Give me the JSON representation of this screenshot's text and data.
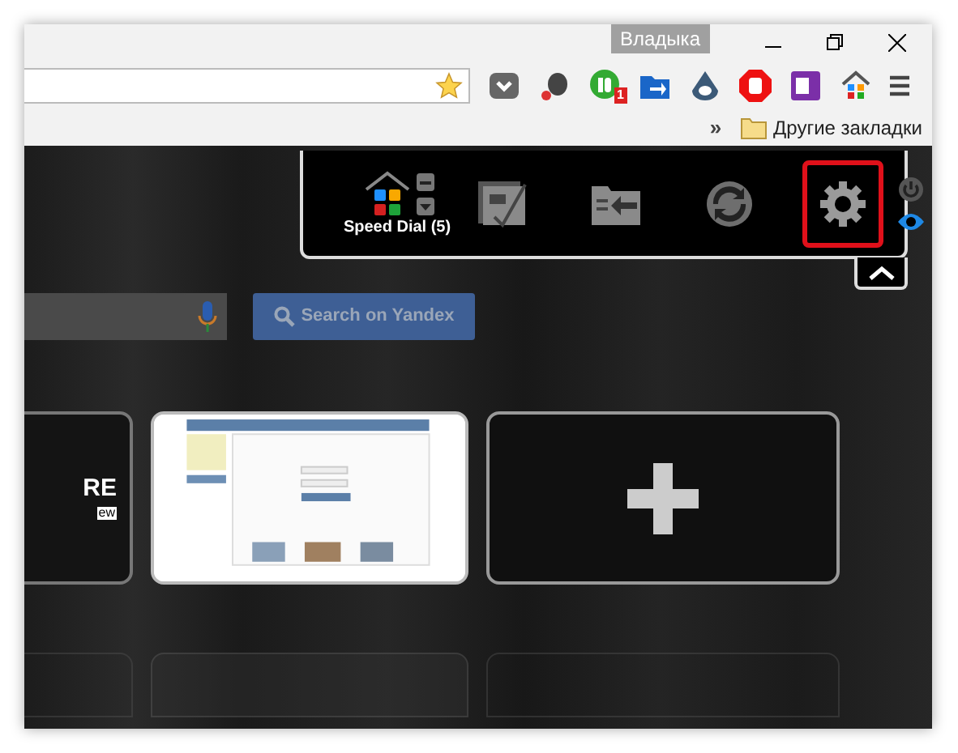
{
  "title_bar": {
    "profile": "Владыка"
  },
  "toolbar": {
    "extensions": [
      {
        "kind": "pocket"
      },
      {
        "kind": "evernote"
      },
      {
        "kind": "pushbullet",
        "badge": "1"
      },
      {
        "kind": "folder"
      },
      {
        "kind": "eye"
      },
      {
        "kind": "stop"
      },
      {
        "kind": "onenote"
      },
      {
        "kind": "speeddial"
      }
    ]
  },
  "bookmarks_bar": {
    "overflow": "»",
    "folder": "Другие закладки"
  },
  "speed_dial_panel": {
    "label": "Speed Dial (5)",
    "items": [
      {
        "kind": "groups",
        "highlighted": false
      },
      {
        "kind": "import",
        "highlighted": false
      },
      {
        "kind": "sync",
        "highlighted": false
      },
      {
        "kind": "settings",
        "highlighted": true
      }
    ],
    "expanded": true
  },
  "search": {
    "button": "Search on Yandex"
  },
  "tiles": [
    {
      "kind": "text",
      "title": "RE",
      "subtitle": "ew"
    },
    {
      "kind": "thumbnail"
    },
    {
      "kind": "add"
    }
  ]
}
